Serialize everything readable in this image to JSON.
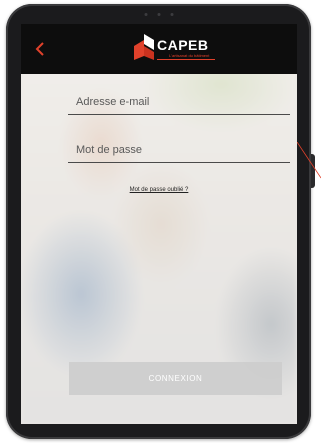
{
  "header": {
    "back_icon": "chevron-left-icon",
    "logo_text": "CAPEB",
    "logo_tagline": "L'artisanat du bâtiment",
    "accent_color": "#e0412b",
    "bar_color": "#0d0d0d"
  },
  "form": {
    "email_placeholder": "Adresse e-mail",
    "password_placeholder": "Mot de passe",
    "forgot_link": "Mot de passe oublié ?",
    "submit_label": "CONNEXION"
  }
}
